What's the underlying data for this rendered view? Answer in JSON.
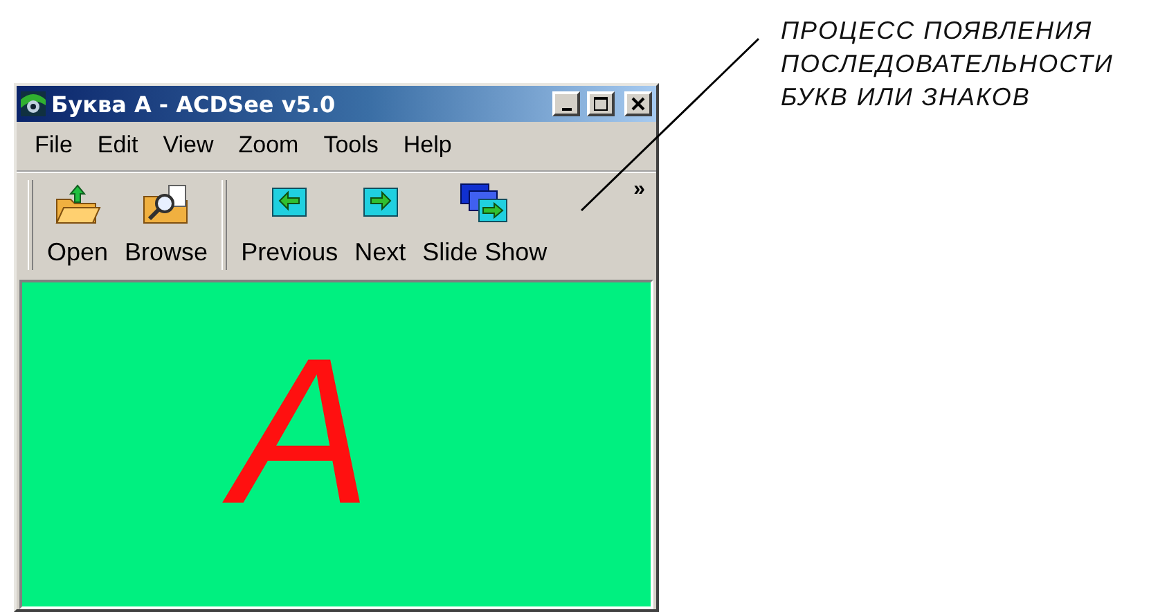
{
  "window": {
    "title": "Буква A - ACDSee v5.0"
  },
  "menu": [
    "File",
    "Edit",
    "View",
    "Zoom",
    "Tools",
    "Help"
  ],
  "toolbar": {
    "groups": [
      [
        {
          "label": "Open",
          "kind": "open"
        },
        {
          "label": "Browse",
          "kind": "browse"
        }
      ],
      [
        {
          "label": "Previous",
          "kind": "previous"
        },
        {
          "label": "Next",
          "kind": "next"
        },
        {
          "label": "Slide Show",
          "kind": "slideshow"
        }
      ]
    ],
    "overflow": "»"
  },
  "viewer": {
    "letter": "A"
  },
  "callout": {
    "lines": [
      "ПРОЦЕСС ПОЯВЛЕНИЯ",
      "ПОСЛЕДОВАТЕЛЬНОСТИ",
      "БУКВ ИЛИ ЗНАКОВ"
    ]
  }
}
